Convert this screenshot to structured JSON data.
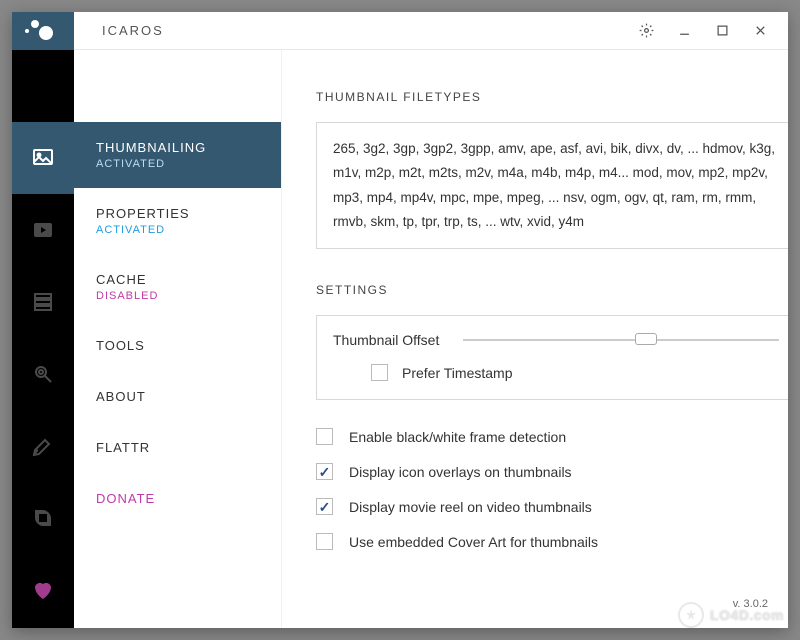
{
  "app": {
    "title": "ICAROS",
    "version": "v. 3.0.2"
  },
  "sidebar": {
    "items": [
      {
        "label": "THUMBNAILING",
        "status": "ACTIVATED",
        "status_kind": "activated",
        "icon": "image-icon"
      },
      {
        "label": "PROPERTIES",
        "status": "ACTIVATED",
        "status_kind": "activated",
        "icon": "play-icon"
      },
      {
        "label": "CACHE",
        "status": "DISABLED",
        "status_kind": "disabled",
        "icon": "stack-icon"
      },
      {
        "label": "TOOLS",
        "status": "",
        "status_kind": "",
        "icon": "gear-wrench-icon"
      },
      {
        "label": "ABOUT",
        "status": "",
        "status_kind": "",
        "icon": "brush-icon"
      },
      {
        "label": "FLATTR",
        "status": "",
        "status_kind": "",
        "icon": "flattr-icon"
      },
      {
        "label": "DONATE",
        "status": "",
        "status_kind": "donate",
        "icon": "heart-icon"
      }
    ]
  },
  "main": {
    "filetypes_label": "THUMBNAIL FILETYPES",
    "filetypes": "265,  3g2,  3gp,  3gp2,  3gpp,  amv,  ape,  asf,  avi,  bik,  divx,  dv,  ... hdmov,  k3g,  m1v,  m2p,  m2t,  m2ts,  m2v,  m4a,  m4b,  m4p,  m4... mod,  mov,  mp2,  mp2v,  mp3,  mp4,  mp4v,  mpc,  mpe,  mpeg,  ... nsv,  ogm,  ogv,  qt,  ram,  rm,  rmm,  rmvb,  skm,  tp,  tpr,  trp,  ts,  ... wtv,  xvid,  y4m",
    "settings_label": "SETTINGS",
    "offset_label": "Thumbnail Offset",
    "prefer_ts_label": "Prefer Timestamp",
    "checks": [
      {
        "label": "Enable black/white frame detection",
        "checked": false
      },
      {
        "label": "Display icon overlays on thumbnails",
        "checked": true
      },
      {
        "label": "Display movie reel on video thumbnails",
        "checked": true
      },
      {
        "label": "Use embedded Cover Art for thumbnails",
        "checked": false
      }
    ]
  },
  "watermark": {
    "text": "LO4D.com"
  }
}
